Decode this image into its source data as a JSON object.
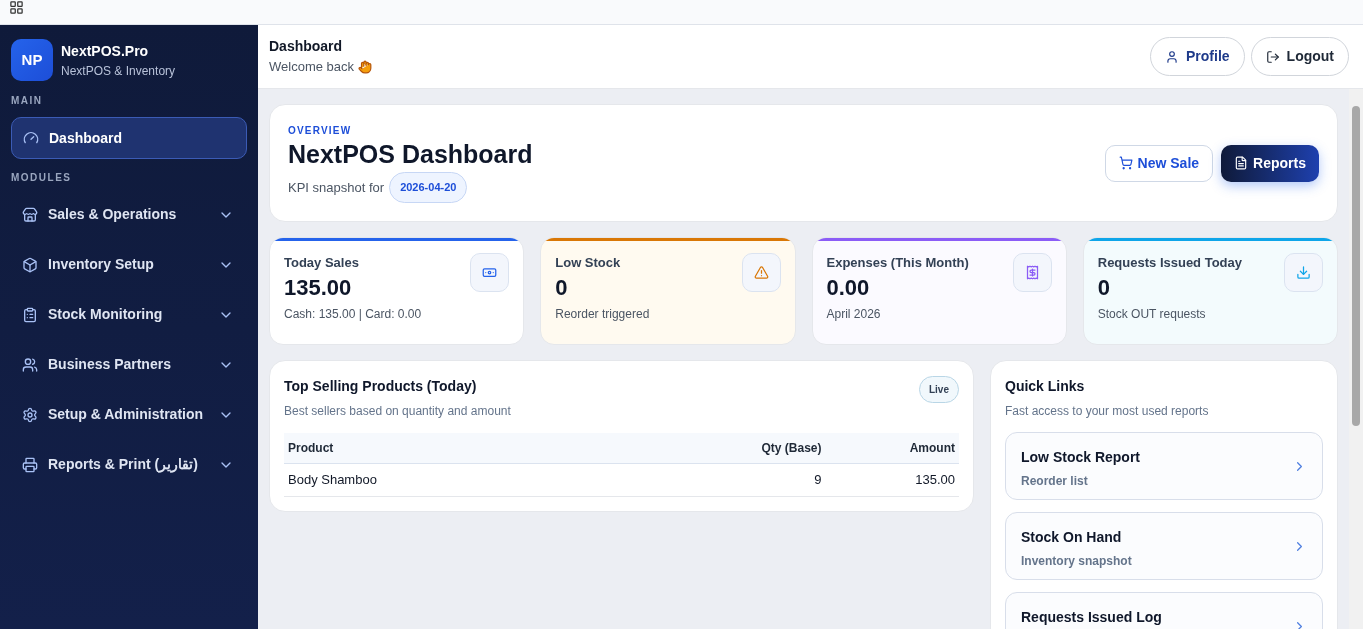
{
  "brand": {
    "logo": "NP",
    "name": "NextPOS.Pro",
    "subtitle": "NextPOS & Inventory"
  },
  "nav": [
    {
      "heading": "MAIN",
      "items": [
        {
          "label": "Dashboard",
          "kind": "link",
          "selected": true
        }
      ]
    },
    {
      "heading": "MODULES",
      "items": [
        {
          "label": "Sales & Operations",
          "kind": "group",
          "selected": false,
          "expanded": false
        },
        {
          "label": "Inventory Setup",
          "kind": "group",
          "selected": false,
          "expanded": false
        },
        {
          "label": "Stock Monitoring",
          "kind": "group",
          "selected": false,
          "expanded": false
        },
        {
          "label": "Business Partners",
          "kind": "group",
          "selected": false,
          "expanded": false
        },
        {
          "label": "Setup & Administration",
          "kind": "group",
          "selected": false,
          "expanded": false
        },
        {
          "label": "Reports & Print (تقارير)",
          "kind": "group",
          "selected": false,
          "expanded": false
        }
      ]
    }
  ],
  "header": {
    "title": "Dashboard",
    "greeting": "Welcome back",
    "buttons": [
      "Profile",
      "Logout"
    ]
  },
  "overview": {
    "eyebrow": "OVERVIEW",
    "title": "NextPOS Dashboard",
    "snapshot_label": "KPI snapshot for",
    "date": "2026-04-20",
    "buttons": [
      "New Sale",
      "Reports"
    ]
  },
  "kpis": [
    {
      "kind": "sales",
      "title": "Today Sales",
      "value": "135.00",
      "note": "Cash: 135.00 | Card: 0.00",
      "color": "#2563eb"
    },
    {
      "kind": "warning",
      "title": "Low Stock",
      "value": "0",
      "note": "Reorder triggered",
      "color": "#d97706"
    },
    {
      "kind": "expenses",
      "title": "Expenses (This Month)",
      "value": "0.00",
      "note": "April 2026",
      "color": "#8b5cf6"
    },
    {
      "kind": "requests",
      "title": "Requests Issued Today",
      "value": "0",
      "note": "Stock OUT requests",
      "color": "#0ea5e9"
    }
  ],
  "top_selling": {
    "title": "Top Selling Products (Today)",
    "subtitle": "Best sellers based on quantity and amount",
    "badge": "Live",
    "columns": [
      "Product",
      "Qty (Base)",
      "Amount"
    ],
    "rows": [
      [
        "Body Shamboo",
        "9",
        "135.00"
      ]
    ]
  },
  "quick_links": {
    "title": "Quick Links",
    "subtitle": "Fast access to your most used reports",
    "items": [
      {
        "title": "Low Stock Report",
        "subtitle": "Reorder list"
      },
      {
        "title": "Stock On Hand",
        "subtitle": "Inventory snapshot"
      },
      {
        "title": "Requests Issued Log"
      }
    ]
  }
}
